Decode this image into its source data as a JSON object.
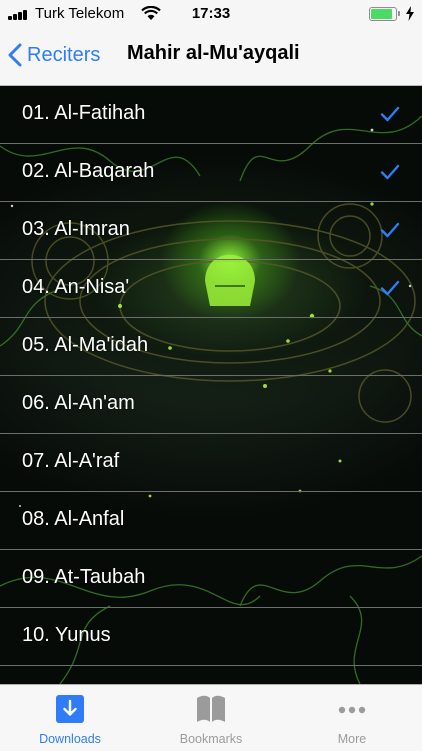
{
  "status_bar": {
    "carrier": "Turk Telekom",
    "time": "17:33",
    "battery_level": 0.9,
    "icons": [
      "signal-icon",
      "wifi-icon",
      "battery-icon",
      "charging-bolt-icon"
    ]
  },
  "nav": {
    "back_label": "Reciters",
    "title": "Mahir al-Mu'ayqali",
    "accent_color": "#2f7cf6"
  },
  "surahs": [
    {
      "label": "01. Al-Fatihah",
      "downloaded": true
    },
    {
      "label": "02. Al-Baqarah",
      "downloaded": true
    },
    {
      "label": "03. Al-Imran",
      "downloaded": true
    },
    {
      "label": "04. An-Nisa'",
      "downloaded": true
    },
    {
      "label": "05. Al-Ma'idah",
      "downloaded": false
    },
    {
      "label": "06. Al-An'am",
      "downloaded": false
    },
    {
      "label": "07. Al-A'raf",
      "downloaded": false
    },
    {
      "label": "08. Al-Anfal",
      "downloaded": false
    },
    {
      "label": "09. At-Taubah",
      "downloaded": false
    },
    {
      "label": "10. Yunus",
      "downloaded": false
    }
  ],
  "tabs": [
    {
      "label": "Downloads",
      "icon": "download-icon",
      "active": true
    },
    {
      "label": "Bookmarks",
      "icon": "book-icon",
      "active": false
    },
    {
      "label": "More",
      "icon": "more-icon",
      "active": false
    }
  ],
  "colors": {
    "active_tab": "#2f7cf6",
    "inactive_tab": "#9b9b9b",
    "checkmark": "#2f7cf6"
  }
}
